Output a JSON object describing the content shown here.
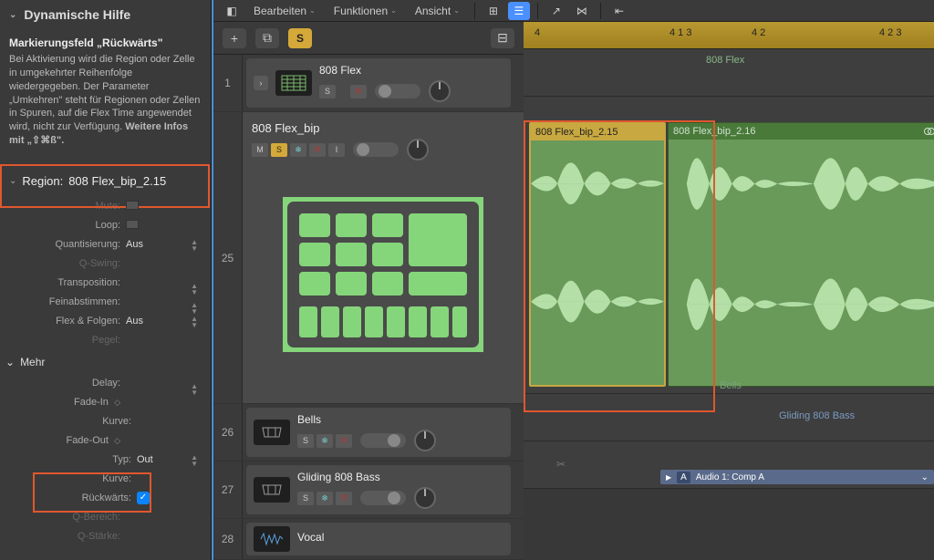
{
  "leftPanel": {
    "title": "Dynamische Hilfe",
    "helpTitle": "Markierungsfeld „Rückwärts\"",
    "helpText": "Bei Aktivierung wird die Region oder Zelle in umgekehrter Reihenfolge wiedergegeben. Der Parameter „Umkehren\" steht für Regionen oder Zellen in Spuren, auf die Flex Time angewendet wird, nicht zur Verfügung.",
    "helpMore": "Weitere Infos mit „⇧⌘ß\".",
    "regionLabel": "Region:",
    "regionName": "808 Flex_bip_2.15",
    "params": {
      "mute": "Mute:",
      "loop": "Loop:",
      "quant": "Quantisierung:",
      "quantVal": "Aus",
      "qswing": "Q-Swing:",
      "transp": "Transposition:",
      "fein": "Feinabstimmen:",
      "flex": "Flex & Folgen:",
      "flexVal": "Aus",
      "pegel": "Pegel:"
    },
    "mehr": "Mehr",
    "mehrParams": {
      "delay": "Delay:",
      "fadein": "Fade-In",
      "kurve": "Kurve:",
      "fadeout": "Fade-Out",
      "typ": "Typ:",
      "typVal": "Out",
      "ruckwarts": "Rückwärts:",
      "qbereich": "Q-Bereich:",
      "qstarke": "Q-Stärke:"
    }
  },
  "toolbar": {
    "bearbeiten": "Bearbeiten",
    "funktionen": "Funktionen",
    "ansicht": "Ansicht",
    "s": "S"
  },
  "tracks": {
    "t1": {
      "num": "1",
      "name": "808 Flex",
      "s": "S",
      "r": "R"
    },
    "t25": {
      "num": "25",
      "name": "808 Flex_bip",
      "m": "M",
      "s": "S",
      "snow": "❄",
      "r": "R",
      "i": "I"
    },
    "t26": {
      "num": "26",
      "name": "Bells",
      "s": "S",
      "snow": "❄",
      "r": "R"
    },
    "t27": {
      "num": "27",
      "name": "Gliding 808 Bass",
      "s": "S",
      "snow": "❄",
      "r": "R"
    },
    "t28": {
      "num": "28",
      "name": "Vocal"
    }
  },
  "ruler": {
    "m4": "4",
    "m413": "4 1 3",
    "m42": "4 2",
    "m423": "4 2 3"
  },
  "arrange": {
    "flexLabel": "808 Flex",
    "region1": "808 Flex_bip_2.15",
    "region2": "808 Flex_bip_2.16",
    "bells": "Bells",
    "gliding": "Gliding 808 Bass",
    "comp": "Audio 1: Comp A",
    "compA": "A"
  }
}
